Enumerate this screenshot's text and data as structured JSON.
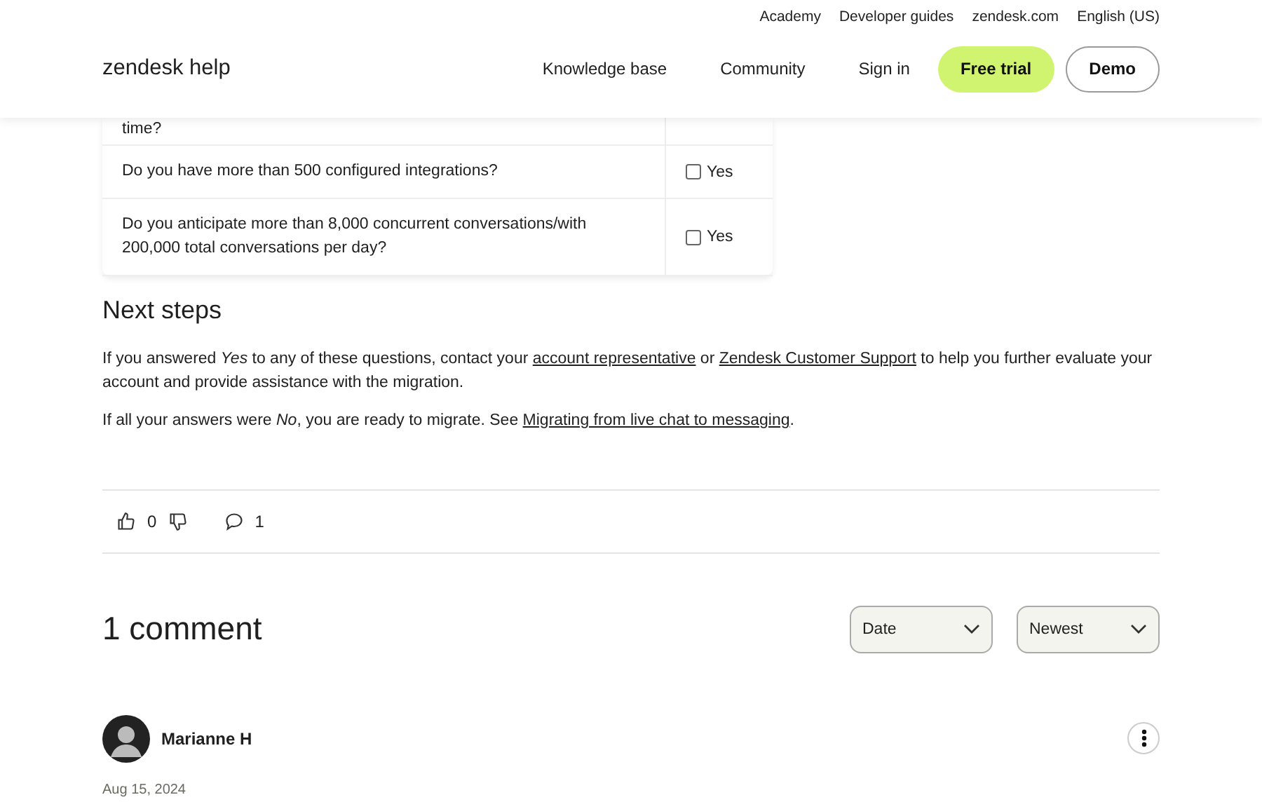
{
  "header": {
    "logo": "zendesk help",
    "top_links": [
      "Academy",
      "Developer guides",
      "zendesk.com",
      "English (US)"
    ],
    "nav": [
      "Knowledge base",
      "Community",
      "Sign in"
    ],
    "buttons": [
      {
        "label": "Free trial",
        "kind": "primary"
      },
      {
        "label": "Demo",
        "kind": "outline"
      }
    ]
  },
  "table": {
    "rows": [
      {
        "question": "time?"
      },
      {
        "question": "Do you have more than 500 configured integrations?",
        "answer": "Yes",
        "checked": false
      },
      {
        "question": "Do you anticipate more than 8,000 concurrent conversations/with 200,000 total conversations per day?",
        "answer": "Yes",
        "checked": false
      }
    ]
  },
  "next_steps": {
    "title": "Next steps",
    "paragraphs": [
      [
        {
          "text": "If you answered *Yes* to any of these questions, contact your "
        },
        {
          "text": "account representative",
          "link": true
        },
        {
          "text": " or "
        },
        {
          "text": "Zendesk Customer Support",
          "link": true
        },
        {
          "text": " to help you further evaluate your account and provide assistance with the migration."
        }
      ],
      [
        {
          "text": "If all your answers were *No*, you are ready to migrate. See "
        },
        {
          "text": "Migrating from live chat to messaging",
          "link": true
        },
        {
          "text": "."
        }
      ]
    ]
  },
  "votes": {
    "up_count": "0",
    "comment_count": "1"
  },
  "comments": {
    "title": "1 comment",
    "sorts": [
      "Date",
      "Newest"
    ],
    "items": [
      {
        "author": "Marianne H",
        "date": "Aug 15, 2024"
      }
    ]
  }
}
